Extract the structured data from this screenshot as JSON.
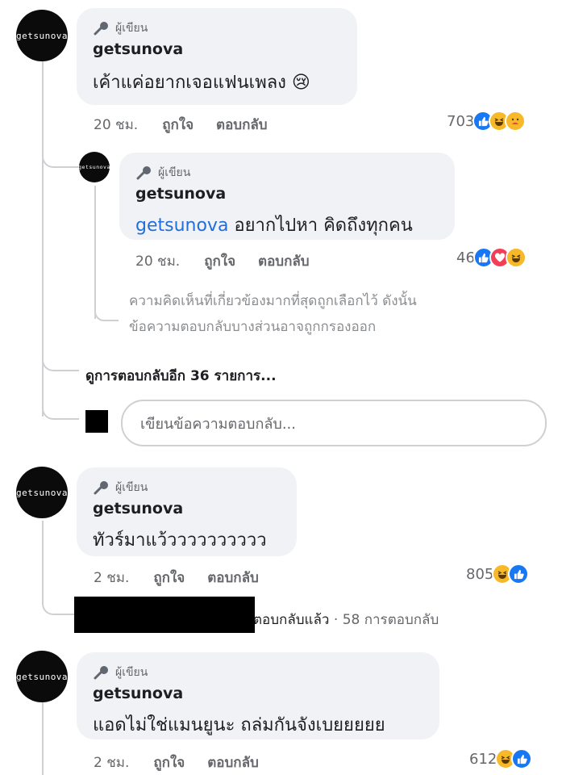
{
  "author_badge": "ผู้เขียน",
  "avatar_text": "getsunova",
  "like_label": "ถูกใจ",
  "reply_label": "ตอบกลับ",
  "comments": [
    {
      "author": "getsunova",
      "text": "เค้าแค่อยากเจอแฟนเพลง 😢",
      "time": "20 ชม.",
      "reaction_count": "703",
      "reactions": [
        "like",
        "haha",
        "care"
      ]
    },
    {
      "author": "getsunova",
      "mention": "getsunova",
      "text": " อยากไปหา คิดถึงทุกคน",
      "time": "20 ชม.",
      "reaction_count": "46",
      "reactions": [
        "like",
        "love",
        "haha"
      ]
    },
    {
      "author": "getsunova",
      "text": "ทัวร์มาแว้วววววววววว",
      "time": "2 ชม.",
      "reaction_count": "805",
      "reactions": [
        "haha",
        "like"
      ]
    },
    {
      "author": "getsunova",
      "text": "แอดไม่ใช่แมนยูนะ ถล่มกันจังเบยยยยย",
      "time": "2 ชม.",
      "reaction_count": "612",
      "reactions": [
        "haha",
        "like"
      ]
    }
  ],
  "relevance_note_line1": "ความคิดเห็นที่เกี่ยวข้องมากที่สุดถูกเลือกไว้ ดังนั้น",
  "relevance_note_line2": "ข้อความตอบกลับบางส่วนอาจถูกกรองออก",
  "more_replies": "ดูการตอบกลับอีก 36 รายการ...",
  "reply_placeholder": "เขียนข้อความตอบกลับ...",
  "reply_summary": {
    "replied": "ตอบกลับแล้ว",
    "separator": " · ",
    "count": "58 การตอบกลับ"
  },
  "colors": {
    "mention": "#216fdb",
    "bubble": "#f0f2f5",
    "like": "#1877f2",
    "love": "#f33e58",
    "haha": "#f7b928"
  }
}
